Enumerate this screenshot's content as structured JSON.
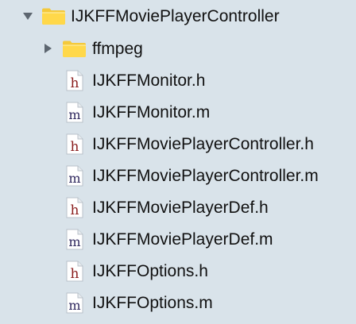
{
  "navigator": {
    "folder": {
      "name": "IJKFFMoviePlayerController",
      "expanded": true,
      "icon": "folder-icon",
      "children": [
        {
          "name": "ffmpeg",
          "type": "folder",
          "expanded": false,
          "icon": "folder-icon"
        },
        {
          "name": "IJKFFMonitor.h",
          "type": "h",
          "icon": "header-file-icon"
        },
        {
          "name": "IJKFFMonitor.m",
          "type": "m",
          "icon": "objc-file-icon"
        },
        {
          "name": "IJKFFMoviePlayerController.h",
          "type": "h",
          "icon": "header-file-icon"
        },
        {
          "name": "IJKFFMoviePlayerController.m",
          "type": "m",
          "icon": "objc-file-icon"
        },
        {
          "name": "IJKFFMoviePlayerDef.h",
          "type": "h",
          "icon": "header-file-icon"
        },
        {
          "name": "IJKFFMoviePlayerDef.m",
          "type": "m",
          "icon": "objc-file-icon"
        },
        {
          "name": "IJKFFOptions.h",
          "type": "h",
          "icon": "header-file-icon"
        },
        {
          "name": "IJKFFOptions.m",
          "type": "m",
          "icon": "objc-file-icon"
        }
      ]
    }
  },
  "colors": {
    "background": "#d9e3ea",
    "folder": "#ffd84a",
    "header_letter": "#8b1f1f",
    "objc_letter": "#30295f",
    "disclosure": "#5d6670"
  }
}
